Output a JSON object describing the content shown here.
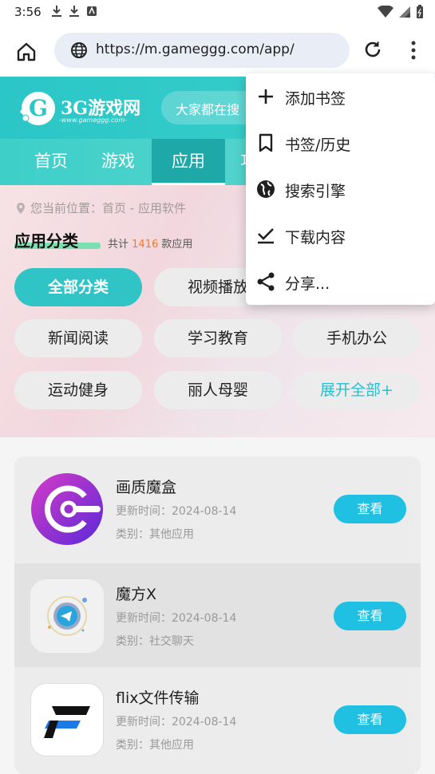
{
  "status_bar": {
    "time": "3:56"
  },
  "browser": {
    "url": "https://m.gameggg.com/app/"
  },
  "site": {
    "logo_text": "3G游戏网",
    "logo_sub": "-www.gameggg.com-",
    "search_placeholder": "大家都在搜",
    "nav": [
      "首页",
      "游戏",
      "应用",
      "攻"
    ]
  },
  "category": {
    "location_label": "您当前位置：首页 - 应用软件",
    "title": "应用分类",
    "count_prefix": "共计",
    "count": "1416",
    "count_suffix": "款应用",
    "chips": [
      {
        "label": "全部分类"
      },
      {
        "label": "视频播放"
      },
      {
        "label": "新闻阅读"
      },
      {
        "label": "学习教育"
      },
      {
        "label": "手机办公"
      },
      {
        "label": "运动健身"
      },
      {
        "label": "丽人母婴"
      },
      {
        "label": "展开全部+"
      }
    ]
  },
  "apps": [
    {
      "name": "画质魔盒",
      "date": "更新时间：2024-08-14",
      "type": "类别：其他应用",
      "button": "查看"
    },
    {
      "name": "魔方X",
      "date": "更新时间：2024-08-14",
      "type": "类别：社交聊天",
      "button": "查看"
    },
    {
      "name": "flix文件传输",
      "date": "更新时间：2024-08-14",
      "type": "类别：其他应用",
      "button": "查看"
    }
  ],
  "menu": [
    {
      "label": "添加书签",
      "icon": "plus-icon"
    },
    {
      "label": "书签/历史",
      "icon": "bookmark-icon"
    },
    {
      "label": "搜索引擎",
      "icon": "globe-icon"
    },
    {
      "label": "下载内容",
      "icon": "download-check-icon"
    },
    {
      "label": "分享...",
      "icon": "share-icon"
    }
  ],
  "colors": {
    "accent_teal": "#31c4c6",
    "button_blue": "#1fc0e2",
    "count_orange": "#f07b2e"
  }
}
